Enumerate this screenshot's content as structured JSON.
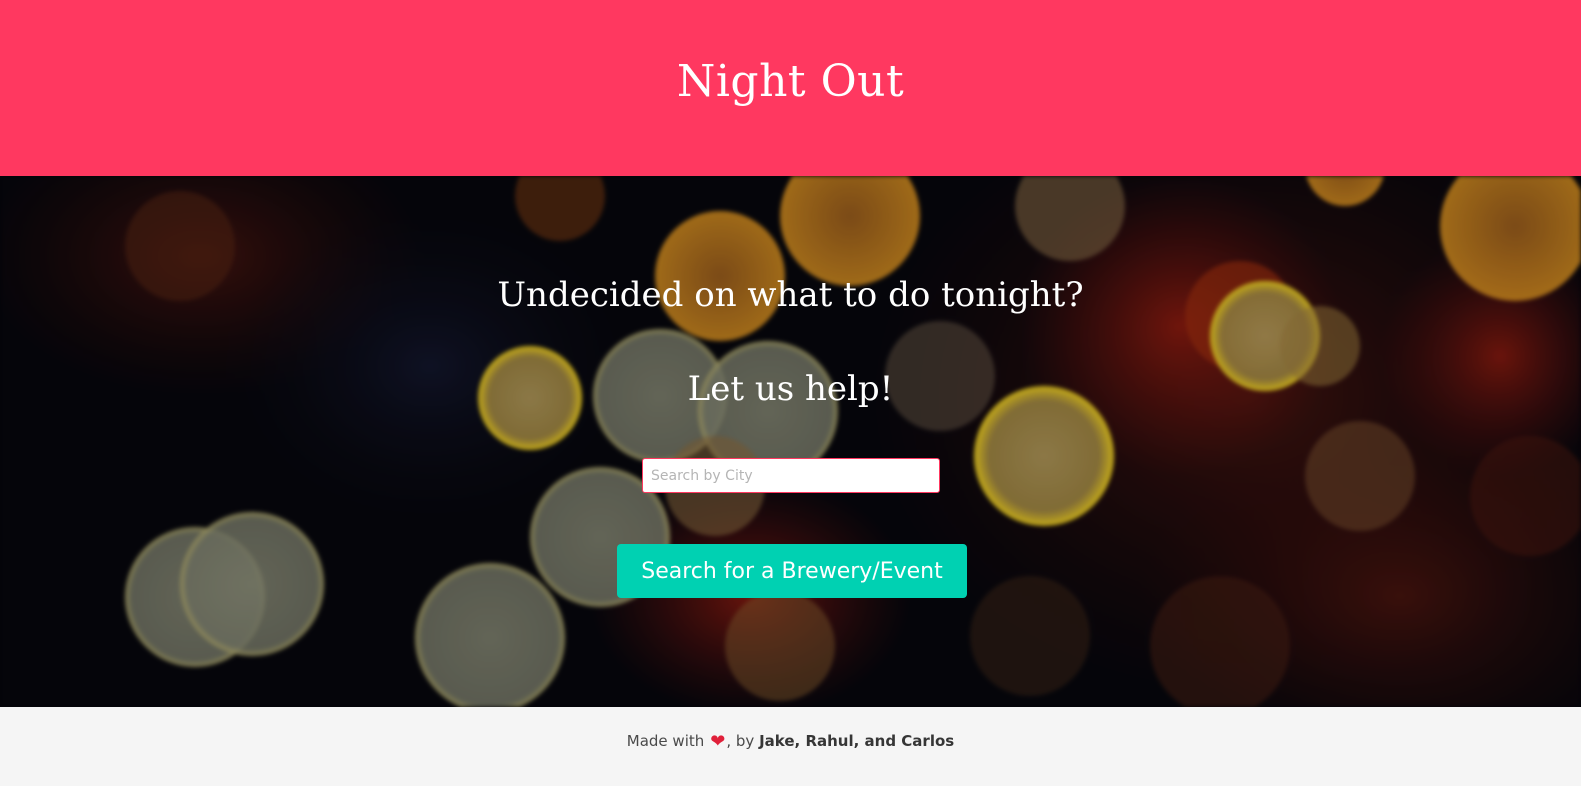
{
  "header": {
    "title": "Night Out",
    "color": "#ff3860"
  },
  "hero": {
    "background": "blurred bokeh city lights",
    "headline_1": "Undecided on what to do tonight?",
    "headline_2": "Let us help!"
  },
  "search": {
    "placeholder": "Search by City",
    "value": "",
    "button_label": "Search for a Brewery/Event",
    "button_color": "#00d1b2"
  },
  "footer": {
    "made_with": "Made with",
    "heart_icon": "heart-icon",
    "by_text": ", by",
    "authors": "Jake, Rahul, and Carlos"
  }
}
